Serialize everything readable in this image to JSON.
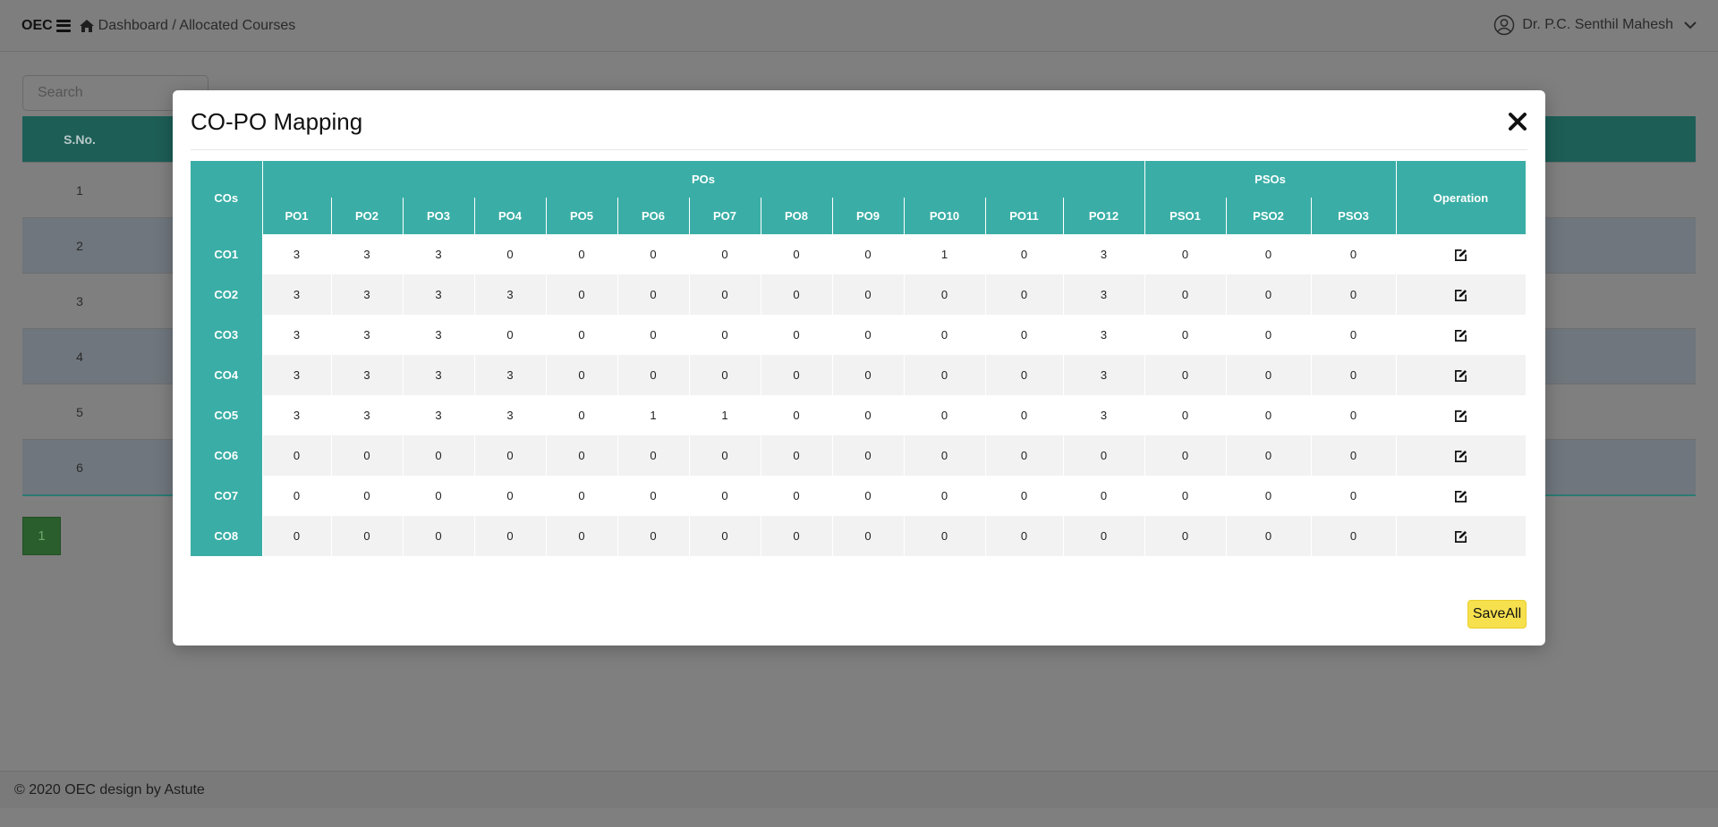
{
  "topbar": {
    "brand": "OEC",
    "breadcrumb": "Dashboard / Allocated Courses",
    "user_name": "Dr. P.C. Senthil Mahesh"
  },
  "search": {
    "placeholder": "Search"
  },
  "background_table": {
    "header_sno": "S.No.",
    "rows": [
      "1",
      "2",
      "3",
      "4",
      "5",
      "6"
    ]
  },
  "pagination": {
    "current_page": "1"
  },
  "footer": {
    "text": "© 2020 OEC design by Astute"
  },
  "modal": {
    "title": "CO-PO Mapping",
    "save_all_label": "SaveAll",
    "table": {
      "cos_header": "COs",
      "pos_header": "POs",
      "psos_header": "PSOs",
      "operation_header": "Operation",
      "po_columns": [
        "PO1",
        "PO2",
        "PO3",
        "PO4",
        "PO5",
        "PO6",
        "PO7",
        "PO8",
        "PO9",
        "PO10",
        "PO11",
        "PO12"
      ],
      "pso_columns": [
        "PSO1",
        "PSO2",
        "PSO3"
      ],
      "rows": [
        {
          "co": "CO1",
          "values": [
            "3",
            "3",
            "3",
            "0",
            "0",
            "0",
            "0",
            "0",
            "0",
            "1",
            "0",
            "3",
            "0",
            "0",
            "0"
          ]
        },
        {
          "co": "CO2",
          "values": [
            "3",
            "3",
            "3",
            "3",
            "0",
            "0",
            "0",
            "0",
            "0",
            "0",
            "0",
            "3",
            "0",
            "0",
            "0"
          ]
        },
        {
          "co": "CO3",
          "values": [
            "3",
            "3",
            "3",
            "0",
            "0",
            "0",
            "0",
            "0",
            "0",
            "0",
            "0",
            "3",
            "0",
            "0",
            "0"
          ]
        },
        {
          "co": "CO4",
          "values": [
            "3",
            "3",
            "3",
            "3",
            "0",
            "0",
            "0",
            "0",
            "0",
            "0",
            "0",
            "3",
            "0",
            "0",
            "0"
          ]
        },
        {
          "co": "CO5",
          "values": [
            "3",
            "3",
            "3",
            "3",
            "0",
            "1",
            "1",
            "0",
            "0",
            "0",
            "0",
            "3",
            "0",
            "0",
            "0"
          ]
        },
        {
          "co": "CO6",
          "values": [
            "0",
            "0",
            "0",
            "0",
            "0",
            "0",
            "0",
            "0",
            "0",
            "0",
            "0",
            "0",
            "0",
            "0",
            "0"
          ]
        },
        {
          "co": "CO7",
          "values": [
            "0",
            "0",
            "0",
            "0",
            "0",
            "0",
            "0",
            "0",
            "0",
            "0",
            "0",
            "0",
            "0",
            "0",
            "0"
          ]
        },
        {
          "co": "CO8",
          "values": [
            "0",
            "0",
            "0",
            "0",
            "0",
            "0",
            "0",
            "0",
            "0",
            "0",
            "0",
            "0",
            "0",
            "0",
            "0"
          ]
        }
      ]
    }
  },
  "colors": {
    "teal_header": "#3aaea6",
    "save_button": "#f6e04e",
    "pager": "#2a5e2c"
  },
  "icons": {
    "menu": "menu-icon",
    "home": "home-icon",
    "user": "user-circle-icon",
    "chevron": "chevron-down-icon",
    "close": "close-icon",
    "edit": "edit-icon"
  }
}
